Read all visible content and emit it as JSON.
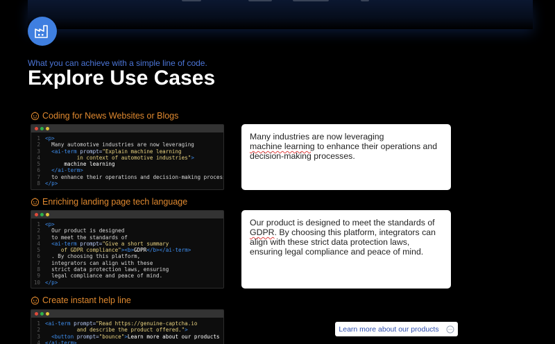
{
  "header": {
    "eyebrow": "What you can achieve with a simple line of code.",
    "title": "Explore Use Cases"
  },
  "icons": {
    "badge": "factory-icon",
    "case": "bot-icon",
    "chat": "chat-bubble-icon"
  },
  "colors": {
    "accent_blue": "#3f7fe0",
    "case_title_orange": "#e0892f",
    "eyebrow_blue": "#4c76d8"
  },
  "use_cases": [
    {
      "title": "Coding for News Websites or Blogs",
      "code": [
        [
          [
            "t",
            "<p>"
          ]
        ],
        [
          [
            "c",
            "  Many automotive industries are now leveraging"
          ]
        ],
        [
          [
            "t",
            "  <ai-term "
          ],
          [
            "a",
            "prompt="
          ],
          [
            "s",
            "\"Explain machine learning"
          ]
        ],
        [
          [
            "s",
            "          in context of automotive industries\""
          ],
          [
            "t",
            ">"
          ]
        ],
        [
          [
            "w",
            "      machine learning"
          ]
        ],
        [
          [
            "t",
            "  </ai-term>"
          ]
        ],
        [
          [
            "c",
            "  to enhance their operations and decision-making processes."
          ]
        ],
        [
          [
            "t",
            "</p>"
          ]
        ]
      ],
      "preview": {
        "before": "Many industries are now leveraging",
        "term": "machine learning",
        "after": " to enhance their operations and decision-making processes."
      }
    },
    {
      "title": "Enriching landing page tech language",
      "code": [
        [
          [
            "t",
            "<p>"
          ]
        ],
        [
          [
            "c",
            "  Our product is designed"
          ]
        ],
        [
          [
            "c",
            "  to meet the standards of"
          ]
        ],
        [
          [
            "t",
            "  <ai-term "
          ],
          [
            "a",
            "prompt="
          ],
          [
            "s",
            "\"Give a short summary"
          ]
        ],
        [
          [
            "s",
            "     of GDPR compliance\""
          ],
          [
            "t",
            ">"
          ],
          [
            "t",
            "<b>"
          ],
          [
            "w",
            "GDPR"
          ],
          [
            "t",
            "</b>"
          ],
          [
            "t",
            "</ai-term>"
          ]
        ],
        [
          [
            "c",
            "  . By choosing this platform,"
          ]
        ],
        [
          [
            "c",
            "  integrators can align with these"
          ]
        ],
        [
          [
            "c",
            "  strict data protection laws, ensuring"
          ]
        ],
        [
          [
            "c",
            "  legal compliance and peace of mind."
          ]
        ],
        [
          [
            "t",
            "</p>"
          ]
        ]
      ],
      "preview": {
        "before": "Our product is designed to meet the standards of ",
        "term": "GDPR",
        "after": ". By choosing this platform, integrators can align with these strict data protection laws, ensuring legal compliance and peace of mind."
      }
    },
    {
      "title": "Create instant help line",
      "code": [
        [
          [
            "t",
            "<ai-term "
          ],
          [
            "a",
            "prompt="
          ],
          [
            "s",
            "\"Read https://genuine-captcha.io"
          ]
        ],
        [
          [
            "s",
            "          and describe the product offered.\""
          ],
          [
            "t",
            ">"
          ]
        ],
        [
          [
            "t",
            "  <button "
          ],
          [
            "a",
            "prompt="
          ],
          [
            "s",
            "\"bounce\""
          ],
          [
            "t",
            ">"
          ],
          [
            "w",
            "Learn more about our products"
          ]
        ],
        [
          [
            "t",
            "</ai-term>"
          ]
        ]
      ],
      "preview": {
        "button_label": "Learn more about our products"
      }
    }
  ]
}
